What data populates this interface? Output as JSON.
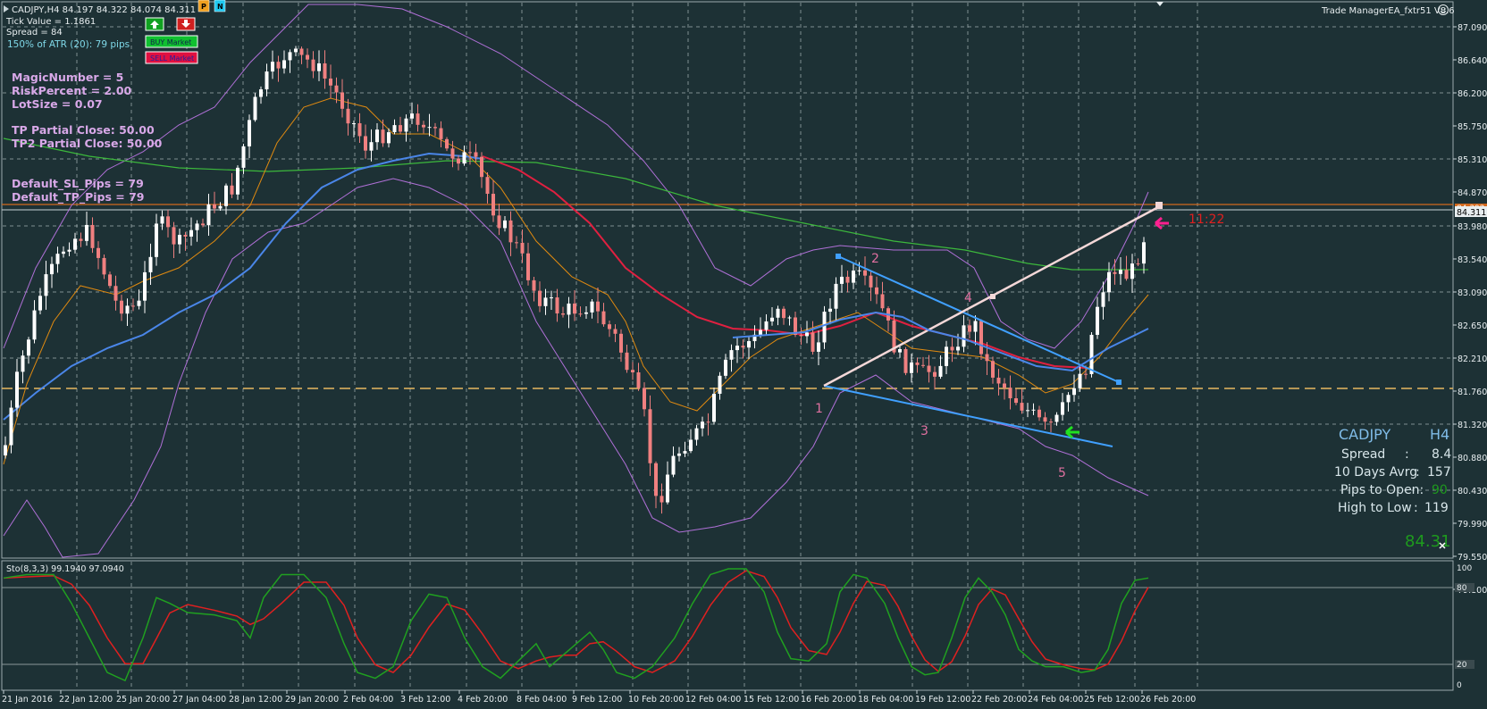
{
  "header": {
    "symbol_line": "CADJPY,H4  84.197 84.322 84.074 84.311",
    "tick_value": "Tick Value = 1.1861",
    "spread": "Spread = 84",
    "atr": "150% of ATR (20): 79 pips",
    "ea_name": "Trade ManagerEA_fxtr51 V8.6"
  },
  "toolbar": {
    "p_label": "P",
    "n_label": "N",
    "buy_label": "BUY Market",
    "sell_label": "SELL Market"
  },
  "settings": {
    "magic": "MagicNumber = 5",
    "risk": "RiskPercent = 2.00",
    "lot": "LotSize = 0.07",
    "tp1": "TP Partial Close: 50.00",
    "tp2": "TP2 Partial Close: 50.00",
    "sl": "Default_SL_Pips = 79",
    "tp": "Default_TP_Pips = 79"
  },
  "info_panel": {
    "symbol": "CADJPY",
    "timeframe": "H4",
    "spread_label": "Spread",
    "spread_sep": ":",
    "spread_value": "8.4",
    "avg_label": "10 Days Avrg",
    "avg_sep": ":",
    "avg_value": "157",
    "pips_label": "Pips to Open:",
    "pips_value": "90",
    "hl_label": "High to Low",
    "hl_sep": ":",
    "hl_value": "119",
    "price": "84.31"
  },
  "countdown": "11:22",
  "wave_labels": [
    "1",
    "2",
    "3",
    "4",
    "5"
  ],
  "price_axis": {
    "labels": [
      "87.090",
      "86.640",
      "86.200",
      "85.750",
      "85.310",
      "84.870",
      "83.980",
      "83.540",
      "83.090",
      "82.650",
      "82.210",
      "81.760",
      "81.320",
      "80.880",
      "80.430",
      "79.990",
      "79.550",
      "79.100"
    ],
    "current_price": "84.311",
    "upper_tag": "84.392"
  },
  "stochastic": {
    "title": "Sto(8,3,3) 99.1940 97.0940",
    "levels": [
      "100",
      "80",
      "20",
      "0"
    ]
  },
  "time_axis": [
    "21 Jan 2016",
    "22 Jan 12:00",
    "25 Jan 20:00",
    "27 Jan 04:00",
    "28 Jan 12:00",
    "29 Jan 20:00",
    "2 Feb 04:00",
    "3 Feb 12:00",
    "4 Feb 20:00",
    "8 Feb 04:00",
    "9 Feb 12:00",
    "10 Feb 20:00",
    "12 Feb 04:00",
    "15 Feb 12:00",
    "16 Feb 20:00",
    "18 Feb 04:00",
    "19 Feb 12:00",
    "22 Feb 20:00",
    "24 Feb 04:00",
    "25 Feb 12:00",
    "26 Feb 20:00"
  ],
  "colors": {
    "background": "#1d3135",
    "bull": "#ffffff",
    "bear": "#f08080",
    "ma_fast": "#e08a10",
    "ma_mid": "#4a86e8",
    "ma_red": "#e02040",
    "ma_slow": "#3cb83c",
    "bollinger": "#b070d8",
    "trend": "#40a0ff",
    "stoch_main": "#20a020",
    "stoch_signal": "#e02020"
  },
  "icons": [
    "up-arrow-icon",
    "down-arrow-icon",
    "smiley-icon",
    "left-arrow-icon"
  ]
}
